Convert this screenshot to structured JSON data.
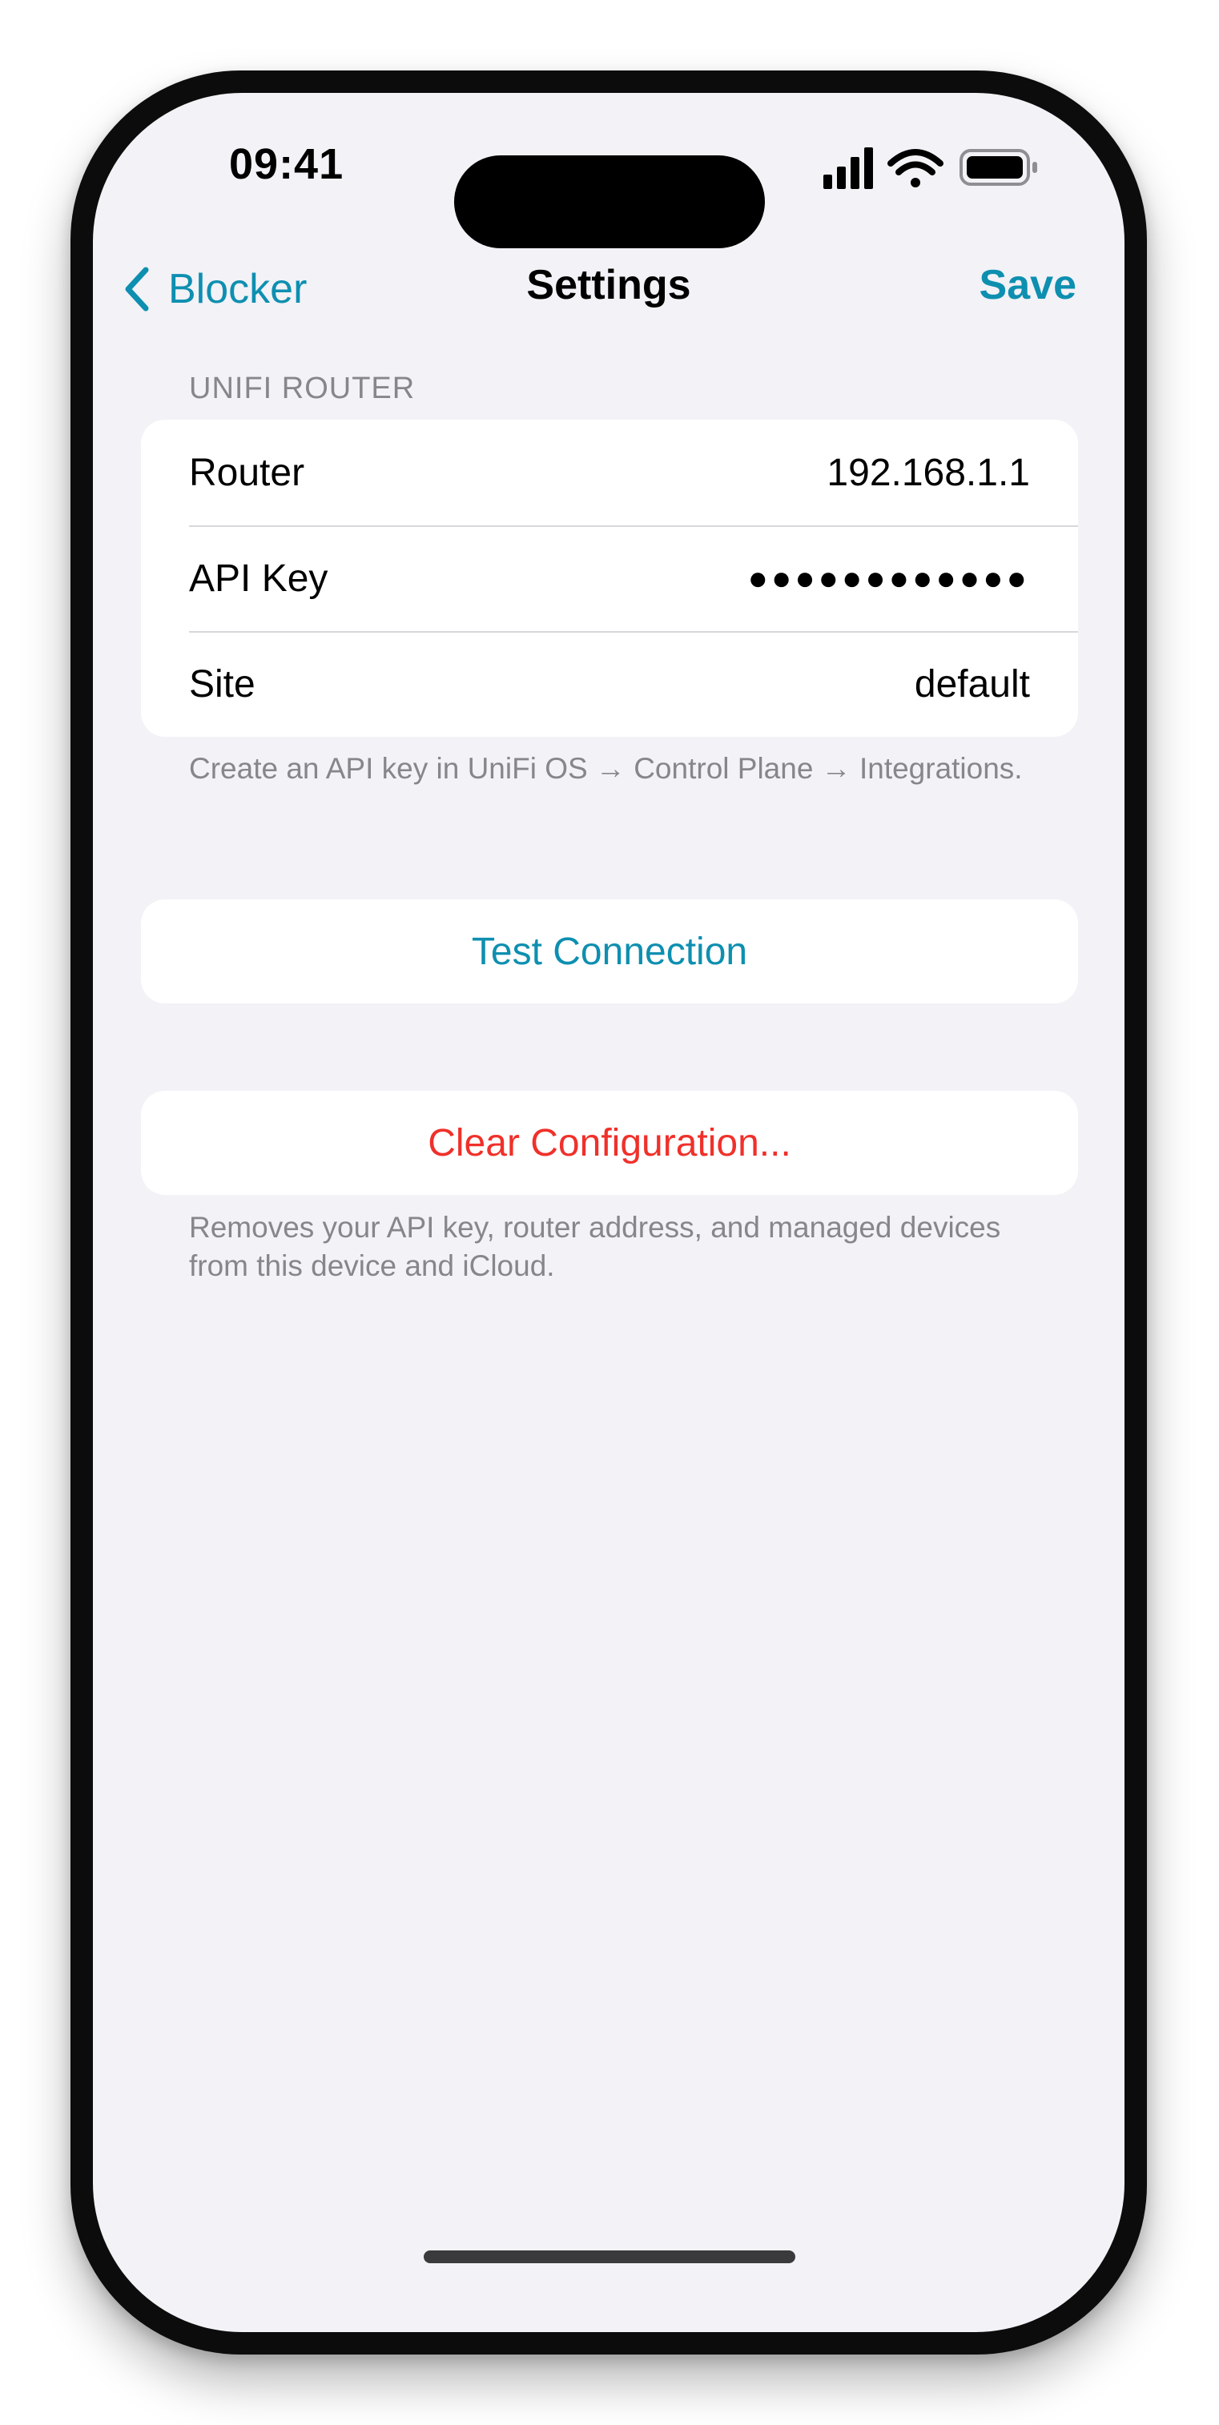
{
  "status_bar": {
    "time": "09:41",
    "icons": [
      "cellular-signal-icon",
      "wifi-icon",
      "battery-icon"
    ]
  },
  "nav": {
    "back_label": "Blocker",
    "title": "Settings",
    "save_label": "Save"
  },
  "unifi_section": {
    "header": "UNIFI ROUTER",
    "rows": [
      {
        "label": "Router",
        "value": "192.168.1.1"
      },
      {
        "label": "API Key",
        "value": "●●●●●●●●●●●●"
      },
      {
        "label": "Site",
        "value": "default"
      }
    ],
    "footer": "Create an API key in UniFi OS → Control Plane → Integrations."
  },
  "test_connection": {
    "label": "Test Connection"
  },
  "clear_section": {
    "label": "Clear Configuration...",
    "footer": "Removes your API key, router address, and managed devices from this device and iCloud."
  },
  "colors": {
    "accent": "#0e8fb0",
    "destructive": "#f0302a",
    "background": "#f2f2f7",
    "secondary_text": "#86868b"
  }
}
